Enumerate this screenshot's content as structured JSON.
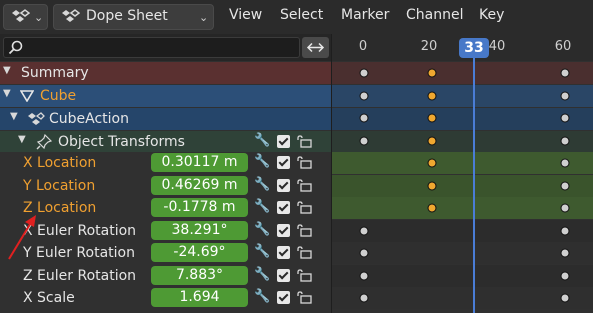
{
  "header": {
    "editor_type_icon": "dope-sheet-editor-icon",
    "mode_label": "Dope Sheet",
    "menus": [
      "View",
      "Select",
      "Marker",
      "Channel",
      "Key"
    ]
  },
  "search": {
    "placeholder": ""
  },
  "timeline": {
    "ticks": [
      "0",
      "20",
      "40",
      "60"
    ],
    "current_frame": "33"
  },
  "channels": {
    "summary": "Summary",
    "object": "Cube",
    "action": "CubeAction",
    "group": "Object Transforms",
    "x_location": {
      "label": "X Location",
      "value": "0.30117 m"
    },
    "y_location": {
      "label": "Y Location",
      "value": "0.46269 m"
    },
    "z_location": {
      "label": "Z Location",
      "value": "-0.1778 m"
    },
    "x_euler": {
      "label": "X Euler Rotation",
      "value": "38.291°"
    },
    "y_euler": {
      "label": "Y Euler Rotation",
      "value": "-24.69°"
    },
    "z_euler": {
      "label": "Z Euler Rotation",
      "value": "7.883°"
    },
    "x_scale": {
      "label": "X Scale",
      "value": "1.694"
    }
  },
  "keyframe_frames": [
    0,
    20,
    60
  ],
  "colors": {
    "summary_row": "#5a3030",
    "object_row": "#2c4f78",
    "action_row": "#25456a",
    "group_row": "#2f4238",
    "location_row": "#3e5a2f",
    "value_field": "#4e9a34",
    "selected_text": "#f0a030",
    "playhead": "#4778c8",
    "keyframe_selected": "#f0a830",
    "keyframe": "#cfcfcf",
    "annotation_arrow": "#e02020"
  }
}
